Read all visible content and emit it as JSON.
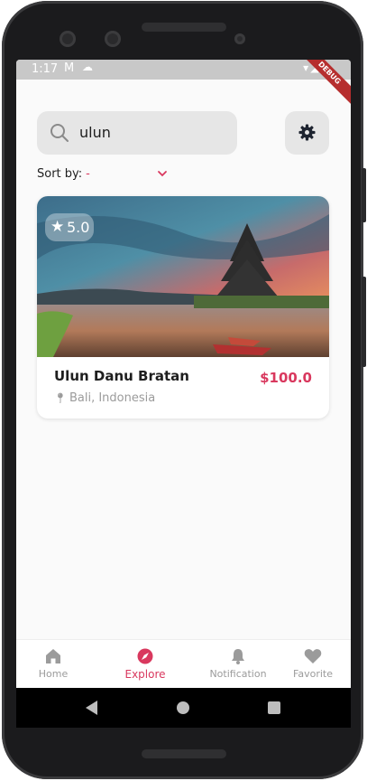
{
  "status_bar": {
    "time": "1:17",
    "icons": [
      "gmail-icon",
      "cloud-icon",
      "wifi-icon",
      "signal-icon",
      "battery-icon"
    ],
    "debug_label": "DEBUG"
  },
  "search": {
    "value": "ulun",
    "icon": "search-icon"
  },
  "settings": {
    "icon": "gear-icon"
  },
  "sort": {
    "label": "Sort by:",
    "value": "-",
    "icon": "chevron-down-icon"
  },
  "result_card": {
    "rating": "5.0",
    "title": "Ulun Danu Bratan",
    "price": "$100.0",
    "location": "Bali, Indonesia"
  },
  "bottom_nav": {
    "items": [
      {
        "label": "Home",
        "icon": "home-icon",
        "active": false
      },
      {
        "label": "Explore",
        "icon": "compass-icon",
        "active": true
      },
      {
        "label": "Notification",
        "icon": "bell-icon",
        "active": false
      },
      {
        "label": "Favorite",
        "icon": "heart-icon",
        "active": false
      }
    ]
  },
  "colors": {
    "accent": "#d9385e",
    "muted": "#9b9b9b",
    "field_bg": "#e6e6e6"
  }
}
